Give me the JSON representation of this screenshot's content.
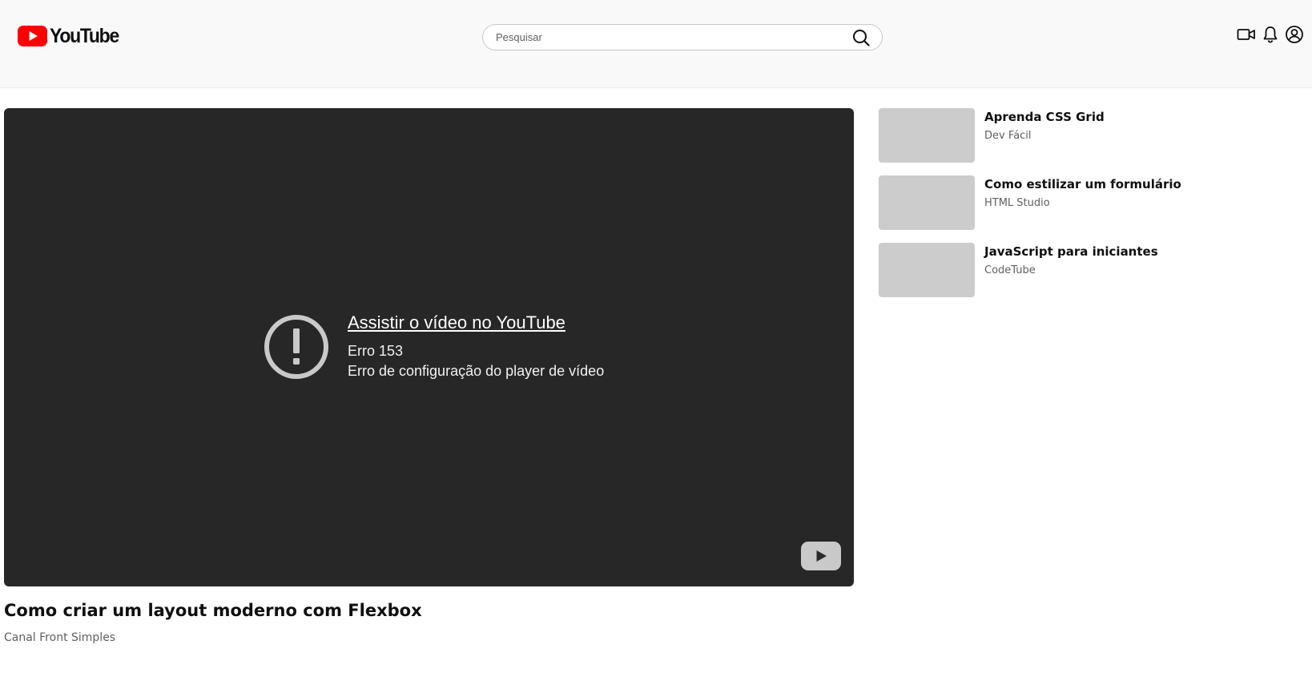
{
  "header": {
    "logo_text": "YouTube",
    "logo_color": "#ff0000",
    "search_placeholder": "Pesquisar",
    "search_value": "",
    "icons": [
      "create-video-icon",
      "notifications-bell-icon",
      "account-icon"
    ]
  },
  "player": {
    "error_link": "Assistir o vídeo no YouTube",
    "error_code": "Erro 153",
    "error_message": "Erro de configuração do player de vídeo",
    "background_color": "#272727"
  },
  "video": {
    "title": "Como criar um layout moderno com Flexbox",
    "channel": "Canal Front Simples"
  },
  "recommendations": [
    {
      "title": "Aprenda CSS Grid",
      "channel": "Dev Fácil"
    },
    {
      "title": "Como estilizar um formulário",
      "channel": "HTML Studio"
    },
    {
      "title": "JavaScript para iniciantes",
      "channel": "CodeTube"
    }
  ]
}
